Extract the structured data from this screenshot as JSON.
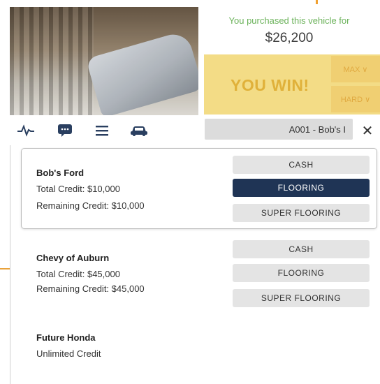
{
  "purchase": {
    "message": "You purchased this vehicle for",
    "amount": "$26,200"
  },
  "result": {
    "win_text": "YOU WIN!",
    "max_label": "MAX ∨",
    "hard_label": "HARD ∨"
  },
  "toolbar": {
    "icons": [
      "activity-icon",
      "chat-icon",
      "menu-icon",
      "car-icon"
    ],
    "dealer_tab": "A001 - Bob's I",
    "close_glyph": "✕"
  },
  "dealers": [
    {
      "name": "Bob's Ford",
      "total_credit": "Total Credit: $10,000",
      "remaining_credit": "Remaining Credit: $10,000",
      "buttons": [
        "CASH",
        "FLOORING",
        "SUPER FLOORING"
      ],
      "selected": "FLOORING"
    },
    {
      "name": "Chevy of Auburn",
      "total_credit": "Total Credit: $45,000",
      "remaining_credit": "Remaining Credit: $45,000",
      "buttons": [
        "CASH",
        "FLOORING",
        "SUPER FLOORING"
      ],
      "selected": ""
    },
    {
      "name": "Future Honda",
      "credit_note": "Unlimited Credit"
    }
  ],
  "colors": {
    "accent_orange": "#e9a23b",
    "purchase_green": "#6bb25a",
    "win_panel": "#f3dc86",
    "selected_button": "#1f3455"
  }
}
